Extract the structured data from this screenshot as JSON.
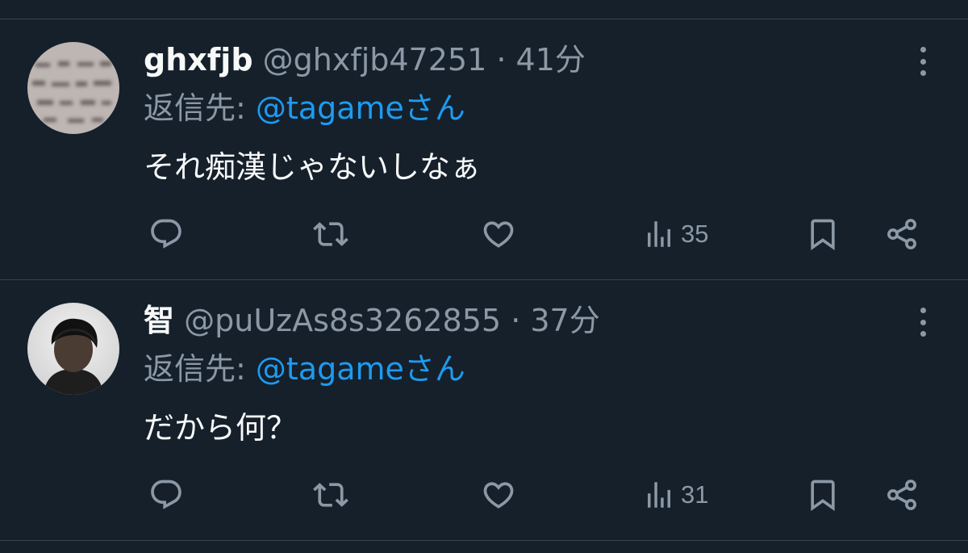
{
  "tweets": [
    {
      "display_name": "ghxfjb",
      "handle": "@ghxfjb47251",
      "separator": "·",
      "time": "41分",
      "reply_prefix": "返信先:",
      "reply_to": "@tagameさん",
      "text": "それ痴漢じゃないしなぁ",
      "views": "35",
      "avatar": "blurred-image-avatar"
    },
    {
      "display_name": "智",
      "handle": "@puUzAs8s3262855",
      "separator": "·",
      "time": "37分",
      "reply_prefix": "返信先:",
      "reply_to": "@tagameさん",
      "text": "だから何？",
      "views": "31",
      "avatar": "person-photo-avatar"
    }
  ],
  "icons": {
    "reply": "reply-icon",
    "retweet": "retweet-icon",
    "like": "heart-icon",
    "views": "views-chart-icon",
    "bookmark": "bookmark-icon",
    "share": "share-icon",
    "more": "more-dots-icon"
  },
  "colors": {
    "background": "#15202b",
    "text": "#f7f9f9",
    "muted": "#8b98a5",
    "accent": "#1d9bf0",
    "divider": "#38444d"
  }
}
